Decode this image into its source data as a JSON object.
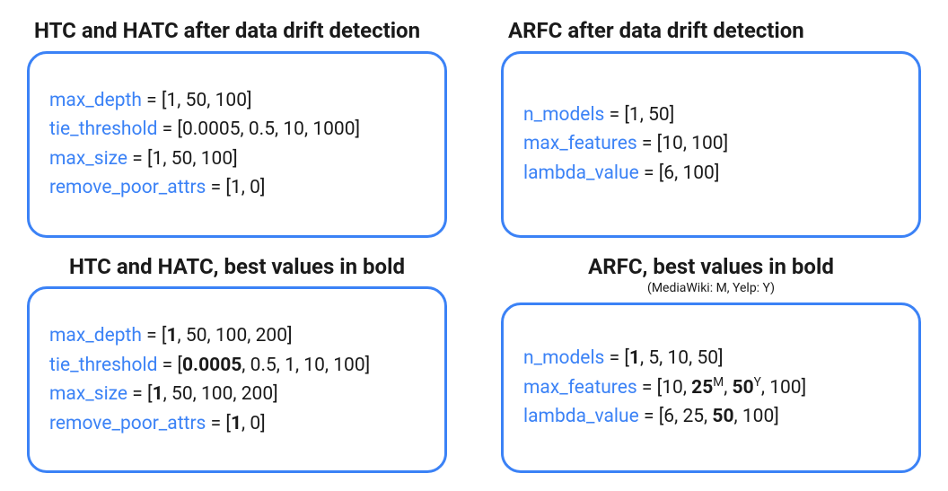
{
  "panels": [
    {
      "title": "HTC and HATC after data drift detection",
      "subtitle": "",
      "titleAlign": "left",
      "params": [
        {
          "name": "max_depth",
          "values": [
            {
              "t": "1"
            },
            {
              "t": "50"
            },
            {
              "t": "100"
            }
          ]
        },
        {
          "name": "tie_threshold",
          "values": [
            {
              "t": "0.0005"
            },
            {
              "t": "0.5"
            },
            {
              "t": "10"
            },
            {
              "t": "1000"
            }
          ]
        },
        {
          "name": "max_size",
          "values": [
            {
              "t": "1"
            },
            {
              "t": "50"
            },
            {
              "t": "100"
            }
          ]
        },
        {
          "name": "remove_poor_attrs",
          "values": [
            {
              "t": "1"
            },
            {
              "t": "0"
            }
          ]
        }
      ]
    },
    {
      "title": "ARFC after data drift detection",
      "subtitle": "",
      "titleAlign": "left",
      "params": [
        {
          "name": "n_models",
          "values": [
            {
              "t": "1"
            },
            {
              "t": "50"
            }
          ]
        },
        {
          "name": "max_features",
          "values": [
            {
              "t": "10"
            },
            {
              "t": "100"
            }
          ]
        },
        {
          "name": "lambda_value",
          "values": [
            {
              "t": "6"
            },
            {
              "t": "100"
            }
          ]
        }
      ]
    },
    {
      "title": "HTC and HATC, best values in bold",
      "subtitle": "",
      "titleAlign": "center",
      "params": [
        {
          "name": "max_depth",
          "values": [
            {
              "t": "1",
              "bold": true
            },
            {
              "t": "50"
            },
            {
              "t": "100"
            },
            {
              "t": "200"
            }
          ]
        },
        {
          "name": "tie_threshold",
          "values": [
            {
              "t": "0.0005",
              "bold": true
            },
            {
              "t": "0.5"
            },
            {
              "t": "1"
            },
            {
              "t": "10"
            },
            {
              "t": "100"
            }
          ]
        },
        {
          "name": "max_size",
          "values": [
            {
              "t": "1",
              "bold": true
            },
            {
              "t": "50"
            },
            {
              "t": "100"
            },
            {
              "t": "200"
            }
          ]
        },
        {
          "name": "remove_poor_attrs",
          "values": [
            {
              "t": "1",
              "bold": true
            },
            {
              "t": "0"
            }
          ]
        }
      ]
    },
    {
      "title": "ARFC, best values in bold",
      "subtitle": "(MediaWiki: M, Yelp: Y)",
      "titleAlign": "center",
      "params": [
        {
          "name": "n_models",
          "values": [
            {
              "t": "1",
              "bold": true
            },
            {
              "t": "5"
            },
            {
              "t": "10"
            },
            {
              "t": "50"
            }
          ]
        },
        {
          "name": "max_features",
          "values": [
            {
              "t": "10"
            },
            {
              "t": "25",
              "bold": true,
              "sup": "M"
            },
            {
              "t": "50",
              "bold": true,
              "sup": "Y"
            },
            {
              "t": "100"
            }
          ]
        },
        {
          "name": "lambda_value",
          "values": [
            {
              "t": "6"
            },
            {
              "t": "25"
            },
            {
              "t": "50",
              "bold": true
            },
            {
              "t": "100"
            }
          ]
        }
      ]
    }
  ]
}
